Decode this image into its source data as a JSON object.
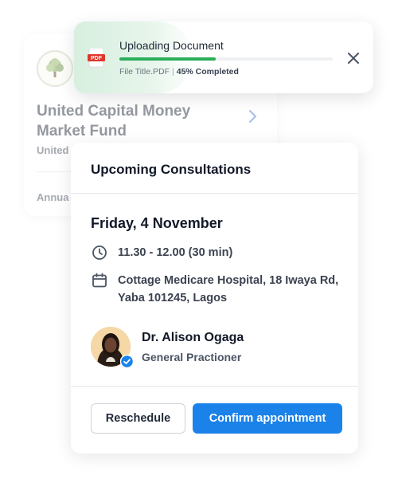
{
  "fund_card": {
    "title": "United Capital Money Market Fund",
    "subtitle": "United",
    "annual_label": "Annua"
  },
  "upload": {
    "title": "Uploading Document",
    "file_badge": "PDF",
    "file_name": "File Title.PDF",
    "separator": "|",
    "progress_text": "45% Completed",
    "progress_fraction": 0.45,
    "progress_color": "#2cae5b"
  },
  "consultation": {
    "header": "Upcoming Consultations",
    "date": "Friday, 4 November",
    "time": "11.30 - 12.00 (30 min)",
    "location": "Cottage Medicare Hospital, 18 Iwaya Rd, Yaba 101245, Lagos",
    "doctor": {
      "name": "Dr. Alison Ogaga",
      "role": "General Practioner"
    },
    "reschedule_label": "Reschedule",
    "confirm_label": "Confirm appointment",
    "accent_color": "#1b82ea"
  },
  "icons": [
    "tree-logo-icon",
    "chevron-right-icon",
    "pdf-file-icon",
    "close-icon",
    "clock-icon",
    "calendar-icon",
    "verified-badge-icon"
  ]
}
